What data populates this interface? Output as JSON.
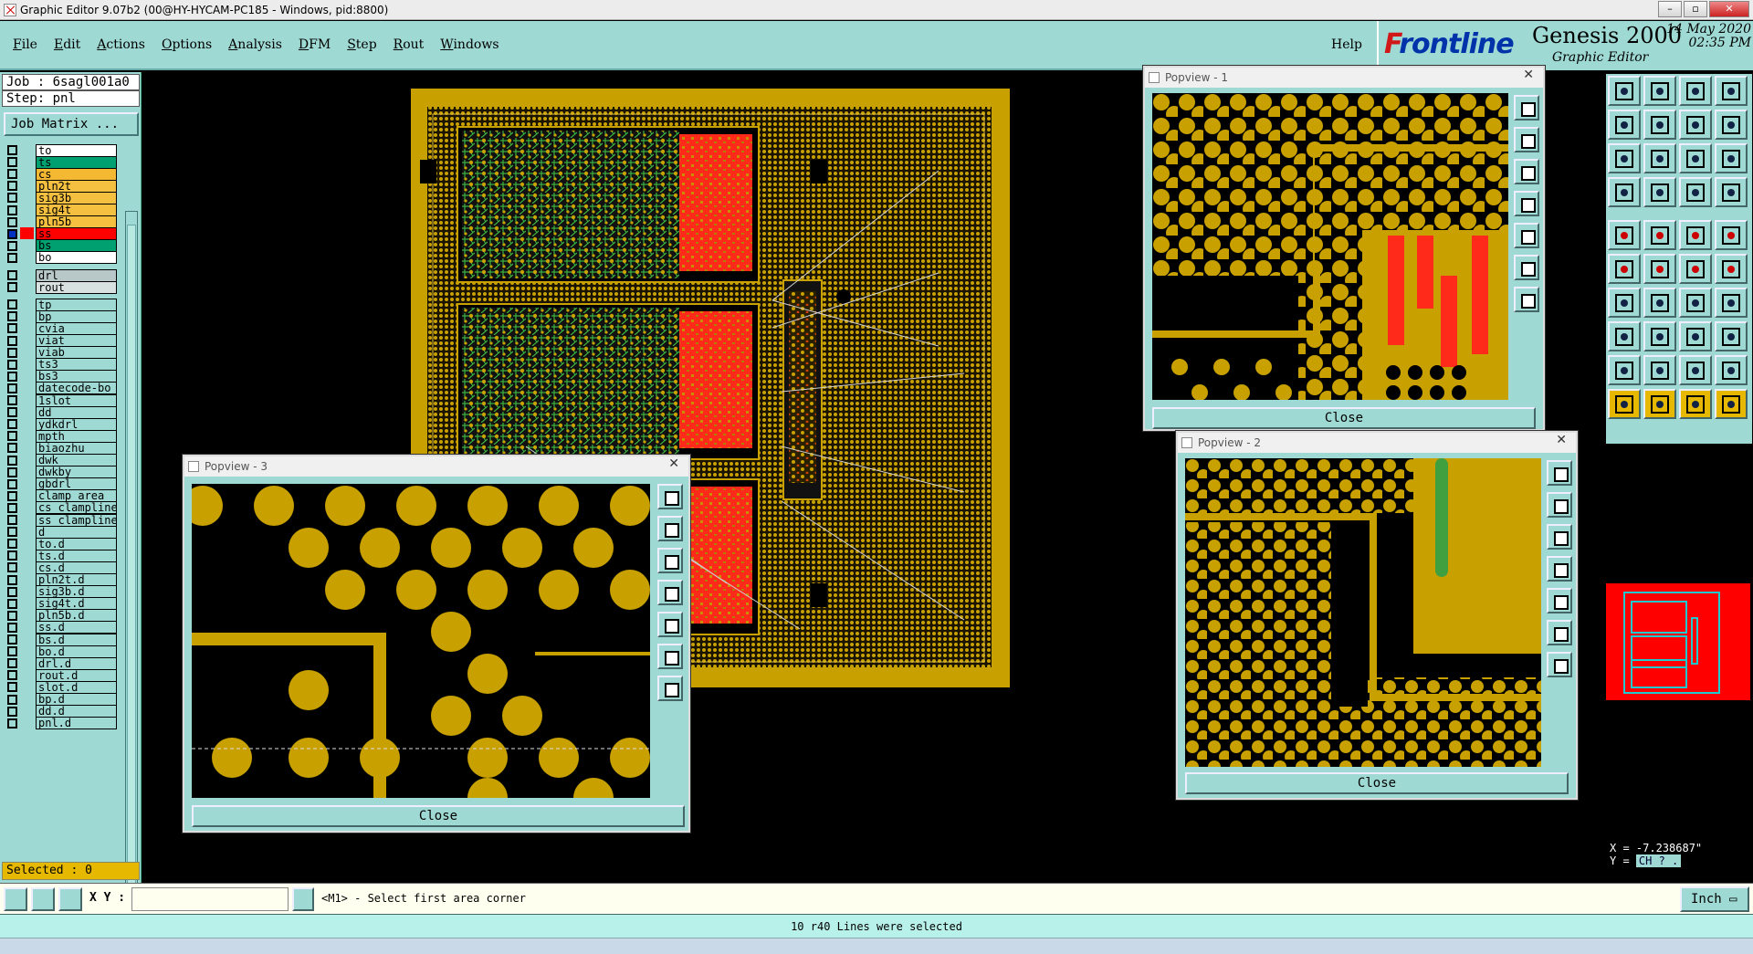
{
  "window": {
    "title": "Graphic Editor 9.07b2 (00@HY-HYCAM-PC185 - Windows, pid:8800)"
  },
  "menu": {
    "items": [
      {
        "label": "File",
        "ul": "F",
        "rest": "ile"
      },
      {
        "label": "Edit",
        "ul": "E",
        "rest": "dit"
      },
      {
        "label": "Actions",
        "ul": "A",
        "rest": "ctions"
      },
      {
        "label": "Options",
        "ul": "O",
        "rest": "ptions"
      },
      {
        "label": "Analysis",
        "ul": "A",
        "rest": "nalysis"
      },
      {
        "label": "DFM",
        "ul": "D",
        "rest": "FM"
      },
      {
        "label": "Step",
        "ul": "S",
        "rest": "tep"
      },
      {
        "label": "Rout",
        "ul": "R",
        "rest": "out"
      },
      {
        "label": "Windows",
        "ul": "W",
        "rest": "indows"
      }
    ],
    "help": "Help"
  },
  "brand": {
    "logo_f": "F",
    "logo": "rontline",
    "product": "Genesis 2000",
    "subtitle": "Graphic Editor",
    "date": "14 May 2020",
    "time": "02:35 PM"
  },
  "job": {
    "job_line": "Job : 6sagl001a0",
    "step_line": "Step: pnl",
    "job_matrix_button": "Job Matrix ..."
  },
  "layers": [
    {
      "name": "to",
      "color": "#ffffff",
      "fill": "#ffffff"
    },
    {
      "name": "ts",
      "color": "#00a070",
      "fill": "#00a070"
    },
    {
      "name": "cs",
      "color": "#ffaa00",
      "fill": "#f5b833"
    },
    {
      "name": "pln2t",
      "color": "#f5c040",
      "fill": "#f5c040"
    },
    {
      "name": "sig3b",
      "color": "#f5c040",
      "fill": "#f5c040"
    },
    {
      "name": "sig4t",
      "color": "#f5c040",
      "fill": "#f5c040"
    },
    {
      "name": "pln5b",
      "color": "#f5c040",
      "fill": "#f5c040"
    },
    {
      "name": "ss",
      "color": "#ff0000",
      "fill": "#ff0000",
      "active": true
    },
    {
      "name": "bs",
      "color": "#00a070",
      "fill": "#00a070"
    },
    {
      "name": "bo",
      "color": "#ffffff",
      "fill": "#ffffff"
    },
    {
      "name": "drl",
      "color": "#b8c8c8",
      "fill": "#b8c8c8"
    },
    {
      "name": "rout",
      "color": "#d8e0e0",
      "fill": "#d8e0e0"
    },
    {
      "name": "tp",
      "fill": "#9ed9d3"
    },
    {
      "name": "bp",
      "fill": "#9ed9d3"
    },
    {
      "name": "cvia",
      "fill": "#9ed9d3"
    },
    {
      "name": "viat",
      "fill": "#9ed9d3"
    },
    {
      "name": "viab",
      "fill": "#9ed9d3"
    },
    {
      "name": "ts3",
      "fill": "#9ed9d3"
    },
    {
      "name": "bs3",
      "fill": "#9ed9d3"
    },
    {
      "name": "datecode-bo",
      "fill": "#9ed9d3"
    },
    {
      "name": "1slot",
      "fill": "#9ed9d3"
    },
    {
      "name": "dd",
      "fill": "#9ed9d3"
    },
    {
      "name": "ydkdrl",
      "fill": "#9ed9d3"
    },
    {
      "name": "mpth",
      "fill": "#9ed9d3"
    },
    {
      "name": "biaozhu",
      "fill": "#9ed9d3"
    },
    {
      "name": "dwk",
      "fill": "#9ed9d3"
    },
    {
      "name": "dwkby",
      "fill": "#9ed9d3"
    },
    {
      "name": "gbdrl",
      "fill": "#9ed9d3"
    },
    {
      "name": "clamp_area",
      "fill": "#9ed9d3"
    },
    {
      "name": "cs_clampline",
      "fill": "#9ed9d3"
    },
    {
      "name": "ss_clampline",
      "fill": "#9ed9d3"
    },
    {
      "name": "d",
      "fill": "#9ed9d3"
    },
    {
      "name": "to.d",
      "fill": "#9ed9d3"
    },
    {
      "name": "ts.d",
      "fill": "#9ed9d3"
    },
    {
      "name": "cs.d",
      "fill": "#9ed9d3"
    },
    {
      "name": "pln2t.d",
      "fill": "#9ed9d3"
    },
    {
      "name": "sig3b.d",
      "fill": "#9ed9d3"
    },
    {
      "name": "sig4t.d",
      "fill": "#9ed9d3"
    },
    {
      "name": "pln5b.d",
      "fill": "#9ed9d3"
    },
    {
      "name": "ss.d",
      "fill": "#9ed9d3"
    },
    {
      "name": "bs.d",
      "fill": "#9ed9d3"
    },
    {
      "name": "bo.d",
      "fill": "#9ed9d3"
    },
    {
      "name": "drl.d",
      "fill": "#9ed9d3"
    },
    {
      "name": "rout.d",
      "fill": "#9ed9d3"
    },
    {
      "name": "slot.d",
      "fill": "#9ed9d3"
    },
    {
      "name": "bp.d",
      "fill": "#9ed9d3"
    },
    {
      "name": "dd.d",
      "fill": "#9ed9d3"
    },
    {
      "name": "pnl.d",
      "fill": "#9ed9d3"
    }
  ],
  "selected_count": "Selected : 0",
  "popviews": {
    "p1": {
      "title": "Popview - 1",
      "close": "Close"
    },
    "p2": {
      "title": "Popview - 2",
      "close": "Close"
    },
    "p3": {
      "title": "Popview - 3",
      "close": "Close"
    }
  },
  "coords": {
    "x": "X = -7.238687\"",
    "y": "Y =",
    "y_extra": "CH ? ."
  },
  "cmd": {
    "xy_label": "X Y :",
    "xy_value": "",
    "prompt": "<M1> - Select first area corner",
    "unit": "Inch"
  },
  "status": "10 r40 Lines were selected",
  "colors": {
    "accent": "#9ed9d3",
    "copper": "#c8a000",
    "soldermask": "#ff2a1a",
    "trace": "#30b050"
  }
}
